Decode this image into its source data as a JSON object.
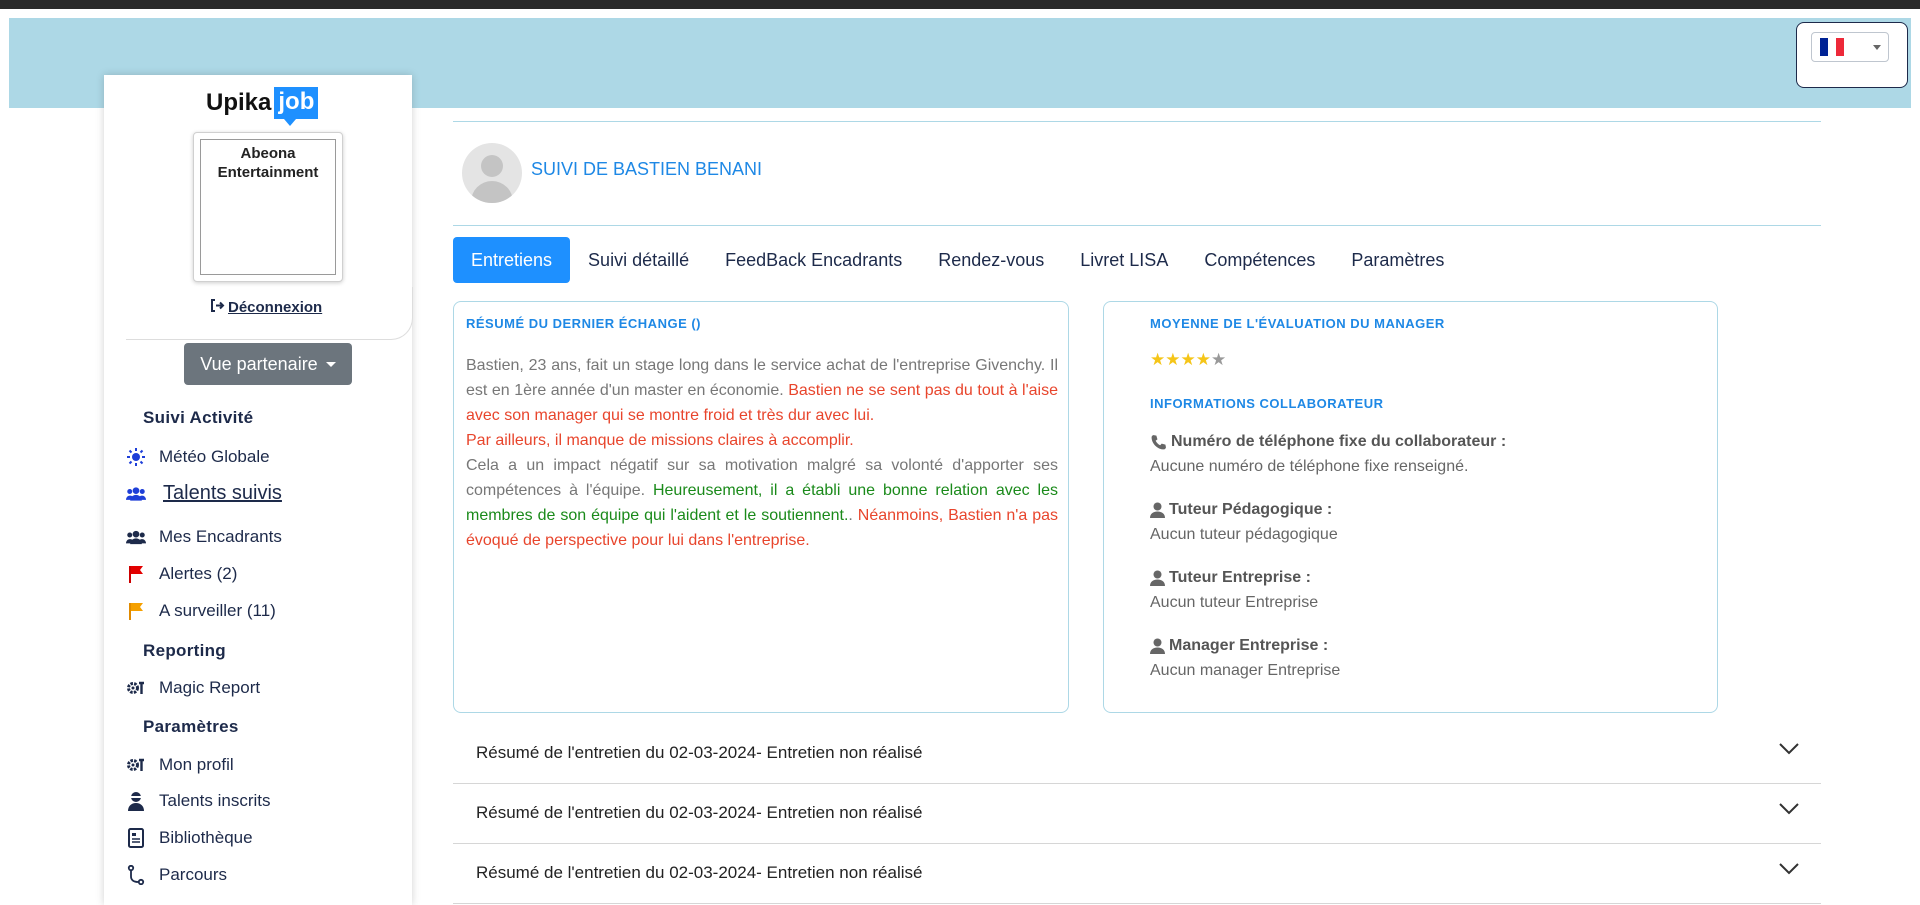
{
  "language": {
    "flag_colors": [
      "#002395",
      "#ffffff",
      "#ed2939"
    ],
    "selected": "fr"
  },
  "sidebar": {
    "logo": {
      "part1": "Upika",
      "part2": "job"
    },
    "company_image_alt": "Abeona Entertainment",
    "logout_label": "Déconnexion",
    "partner_view_label": "Vue partenaire",
    "sections": [
      {
        "title": "Suivi Activité"
      },
      {
        "title": "Reporting"
      },
      {
        "title": "Paramètres"
      }
    ],
    "items": [
      {
        "label": "Météo Globale",
        "icon": "sun-icon"
      },
      {
        "label": "Talents suivis",
        "icon": "users-icon"
      },
      {
        "label": "Mes Encadrants",
        "icon": "users-icon"
      },
      {
        "label": "Alertes (2)",
        "icon": "red-flag-icon"
      },
      {
        "label": "A surveiller (11)",
        "icon": "orange-flag-icon"
      },
      {
        "label": "Magic Report",
        "icon": "tools-icon"
      },
      {
        "label": "Mon profil",
        "icon": "tools-icon"
      },
      {
        "label": "Talents inscrits",
        "icon": "user-icon"
      },
      {
        "label": "Bibliothèque",
        "icon": "document-icon"
      },
      {
        "label": "Parcours",
        "icon": "route-icon"
      }
    ]
  },
  "header": {
    "title": "SUIVI DE BASTIEN BENANI"
  },
  "tabs": [
    {
      "label": "Entretiens"
    },
    {
      "label": "Suivi détaillé"
    },
    {
      "label": "FeedBack Encadrants"
    },
    {
      "label": "Rendez-vous"
    },
    {
      "label": "Livret LISA"
    },
    {
      "label": "Compétences"
    },
    {
      "label": "Paramètres"
    }
  ],
  "summary_card": {
    "heading": "RÉSUMÉ DU DERNIER ÉCHANGE ()",
    "segments": [
      {
        "text": "Bastien, 23 ans, fait un stage long dans le service achat de l'entreprise Givenchy. Il est en 1ère année d'un master en économie. ",
        "tone": "neutral"
      },
      {
        "text": "Bastien ne se sent pas du tout à l'aise avec son manager qui se montre froid et très dur avec lui.",
        "tone": "negative"
      },
      {
        "text": "Par ailleurs, il manque de missions claires à accomplir.",
        "tone": "negative"
      },
      {
        "text": "Cela a un impact négatif sur sa motivation malgré sa volonté d'apporter ses compétences à l'équipe. ",
        "tone": "neutral"
      },
      {
        "text": "Heureusement, il a établi une bonne relation avec les membres de son équipe qui l'aident et le soutiennent.",
        "tone": "positive"
      },
      {
        "text": ". ",
        "tone": "neutral"
      },
      {
        "text": "Néanmoins, Bastien n'a pas évoqué de perspective pour lui dans l'entreprise.",
        "tone": "negative"
      }
    ]
  },
  "info_card": {
    "rating_heading": "MOYENNE DE L'ÉVALUATION DU MANAGER",
    "rating": 4,
    "rating_max": 5,
    "info_heading": "INFORMATIONS COLLABORATEUR",
    "fields": [
      {
        "label": "Numéro de téléphone fixe du collaborateur :",
        "value": "Aucune numéro de téléphone fixe renseigné.",
        "icon": "phone-icon"
      },
      {
        "label": "Tuteur Pédagogique :",
        "value": "Aucun tuteur pédagogique",
        "icon": "person-icon"
      },
      {
        "label": "Tuteur Entreprise :",
        "value": "Aucun tuteur Entreprise",
        "icon": "person-icon"
      },
      {
        "label": "Manager Entreprise :",
        "value": "Aucun manager Entreprise",
        "icon": "person-icon"
      }
    ]
  },
  "interviews": [
    {
      "label": "Résumé de l'entretien du 02-03-2024- Entretien non réalisé"
    },
    {
      "label": "Résumé de l'entretien du 02-03-2024- Entretien non réalisé"
    },
    {
      "label": "Résumé de l'entretien du 02-03-2024- Entretien non réalisé"
    }
  ]
}
